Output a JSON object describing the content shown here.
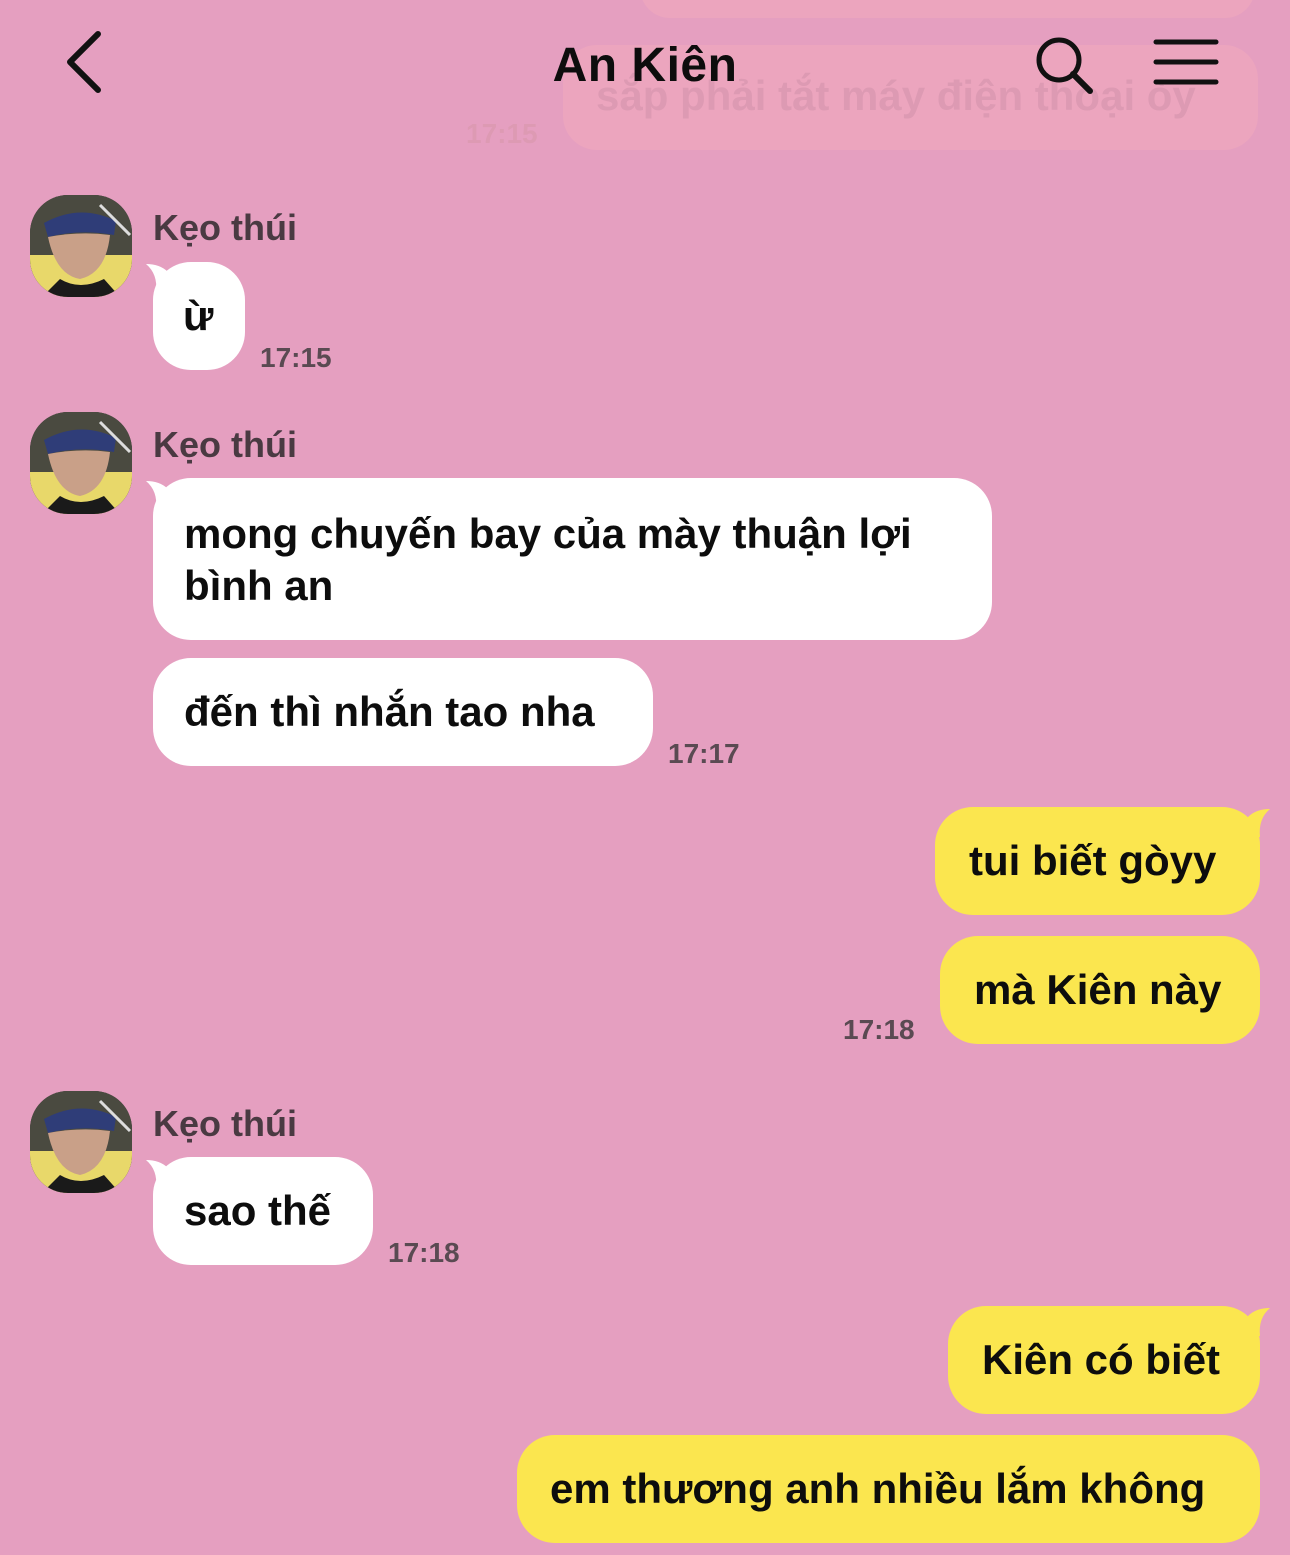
{
  "header": {
    "title": "An Kiên"
  },
  "faded_previous": {
    "text": "sắp phải tắt máy điện thoại òy",
    "time": "17:15"
  },
  "messages": [
    {
      "sender": "Kẹo thúi",
      "text": "ừ",
      "time": "17:15"
    },
    {
      "sender": "Kẹo thúi",
      "lines": [
        "mong chuyến bay của mày thuận lợi",
        "bình an"
      ],
      "text2": "đến thì nhắn tao nha",
      "time": "17:17"
    },
    {
      "text": "tui biết gòyy",
      "text2": "mà Kiên này",
      "time": "17:18"
    },
    {
      "sender": "Kẹo thúi",
      "text": "sao thế",
      "time": "17:18"
    },
    {
      "text": "Kiên có biết",
      "text2": "em thương anh nhiều lắm không"
    }
  ],
  "colors": {
    "background": "#e59fc0",
    "incoming_bubble": "#ffffff",
    "outgoing_bubble": "#fbe64f"
  },
  "icons": [
    "back-chevron-icon",
    "search-icon",
    "menu-icon"
  ]
}
